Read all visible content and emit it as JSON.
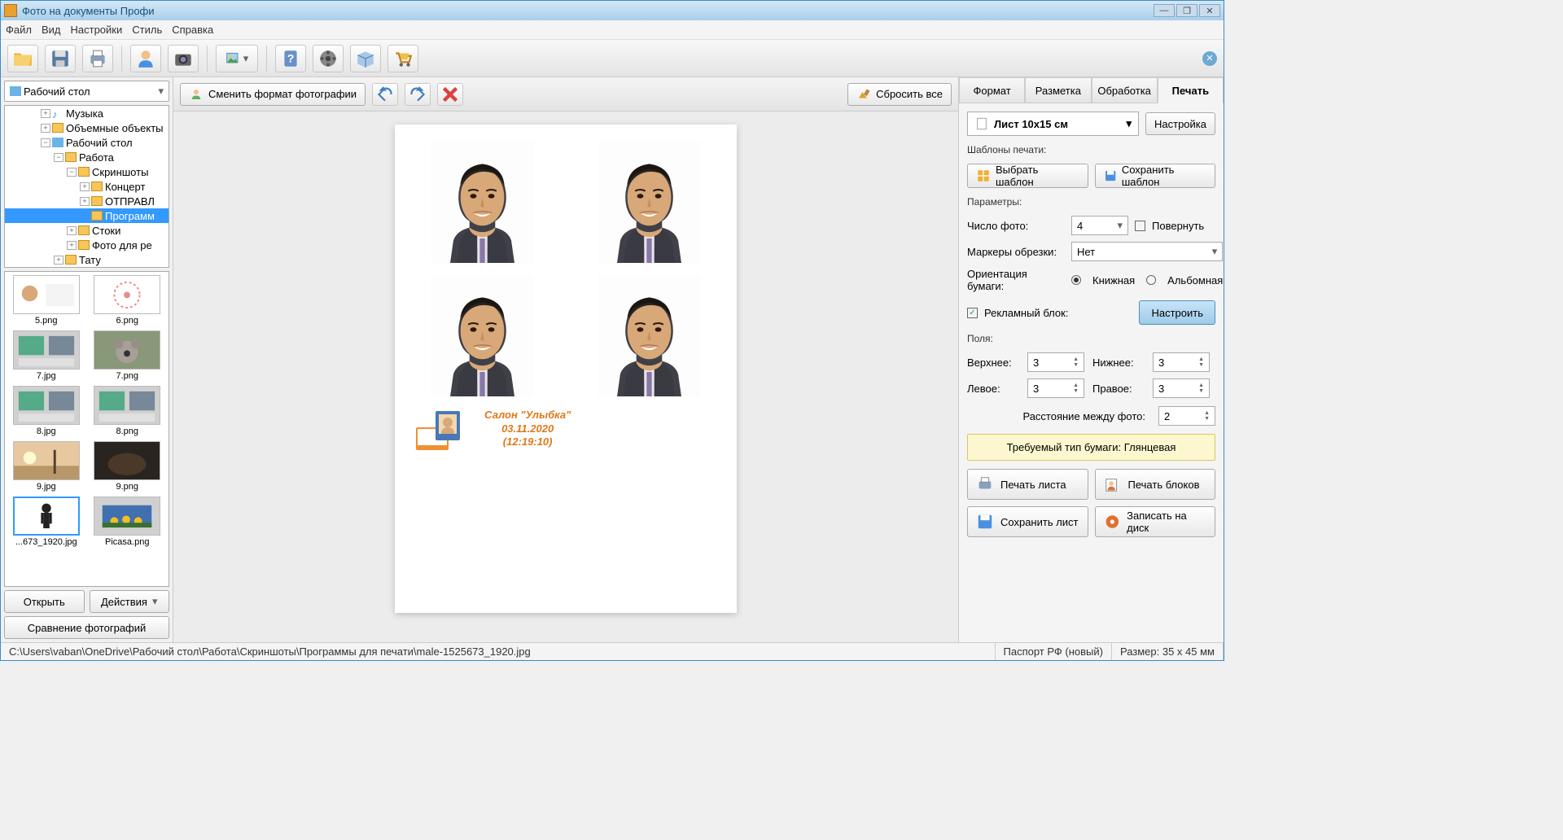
{
  "title": "Фото на документы Профи",
  "menu": [
    "Файл",
    "Вид",
    "Настройки",
    "Стиль",
    "Справка"
  ],
  "left": {
    "combo": "Рабочий стол",
    "tree": [
      {
        "indent": 44,
        "tw": "+",
        "icon": "music",
        "label": "Музыка"
      },
      {
        "indent": 44,
        "tw": "+",
        "icon": "fold",
        "label": "Объемные объекты"
      },
      {
        "indent": 44,
        "tw": "−",
        "icon": "desk",
        "label": "Рабочий стол"
      },
      {
        "indent": 60,
        "tw": "−",
        "icon": "fold",
        "label": "Работа"
      },
      {
        "indent": 76,
        "tw": "−",
        "icon": "fold",
        "label": "Скриншоты"
      },
      {
        "indent": 92,
        "tw": "+",
        "icon": "fold",
        "label": "Концерт"
      },
      {
        "indent": 92,
        "tw": "+",
        "icon": "fold",
        "label": "ОТПРАВЛ"
      },
      {
        "indent": 92,
        "tw": "",
        "icon": "fold",
        "label": "Программ",
        "sel": true
      },
      {
        "indent": 76,
        "tw": "+",
        "icon": "fold",
        "label": "Стоки"
      },
      {
        "indent": 76,
        "tw": "+",
        "icon": "fold",
        "label": "Фото для ре"
      },
      {
        "indent": 60,
        "tw": "+",
        "icon": "fold",
        "label": "Тату"
      }
    ],
    "thumbs": [
      {
        "cap": "5.png",
        "kind": "face"
      },
      {
        "cap": "6.png",
        "kind": "diagram"
      },
      {
        "cap": "7.jpg",
        "kind": "screens"
      },
      {
        "cap": "7.png",
        "kind": "koala"
      },
      {
        "cap": "8.jpg",
        "kind": "screens"
      },
      {
        "cap": "8.png",
        "kind": "screens"
      },
      {
        "cap": "9.jpg",
        "kind": "sunset"
      },
      {
        "cap": "9.png",
        "kind": "dark"
      },
      {
        "cap": "...673_1920.jpg",
        "kind": "person",
        "sel": true
      },
      {
        "cap": "Picasa.png",
        "kind": "flowers"
      }
    ],
    "open": "Открыть",
    "actions": "Действия",
    "compare": "Сравнение фотографий"
  },
  "center": {
    "change_format": "Сменить формат фотографии",
    "reset_all": "Сбросить все",
    "ad": {
      "line1": "Салон \"Улыбка\"",
      "line2": "03.11.2020",
      "line3": "(12:19:10)"
    }
  },
  "right": {
    "tabs": [
      "Формат",
      "Разметка",
      "Обработка",
      "Печать"
    ],
    "active_tab": 3,
    "sheet": "Лист 10x15 см",
    "settings_btn": "Настройка",
    "templates_label": "Шаблоны печати:",
    "choose_tpl": "Выбрать шаблон",
    "save_tpl": "Сохранить шаблон",
    "params_label": "Параметры:",
    "count_label": "Число фото:",
    "count_val": "4",
    "rotate": "Повернуть",
    "crop_label": "Маркеры обрезки:",
    "crop_val": "Нет",
    "orient_label": "Ориентация бумаги:",
    "orient_book": "Книжная",
    "orient_land": "Альбомная",
    "ad_block": "Рекламный блок:",
    "configure": "Настроить",
    "fields_label": "Поля:",
    "top": "Верхнее:",
    "bottom": "Нижнее:",
    "left": "Левое:",
    "rightm": "Правое:",
    "gap": "Расстояние между фото:",
    "m": {
      "top": "3",
      "bottom": "3",
      "left": "3",
      "right": "3",
      "gap": "2"
    },
    "paper_note": "Требуемый тип бумаги: Глянцевая",
    "print_sheet": "Печать листа",
    "print_blocks": "Печать блоков",
    "save_sheet": "Сохранить лист",
    "burn": "Записать на диск"
  },
  "status": {
    "path": "C:\\Users\\vaban\\OneDrive\\Рабочий стол\\Работа\\Скриншоты\\Программы для печати\\male-1525673_1920.jpg",
    "format": "Паспорт РФ (новый)",
    "size": "Размер: 35 x 45 мм"
  }
}
